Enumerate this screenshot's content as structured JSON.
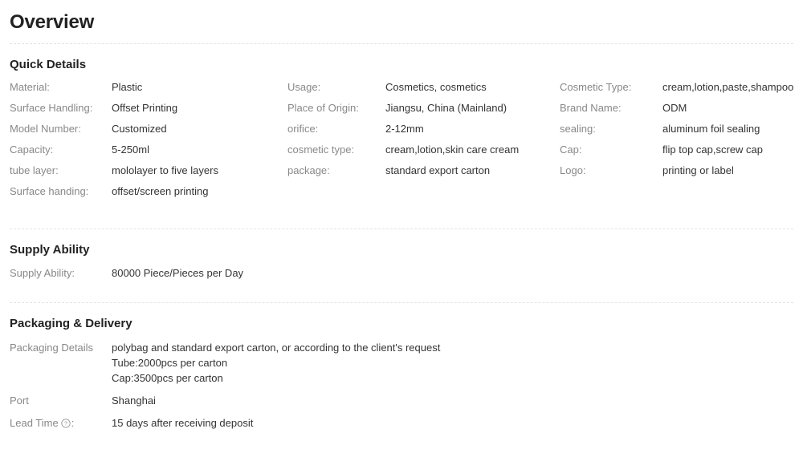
{
  "page": {
    "title": "Overview"
  },
  "quick_details": {
    "heading": "Quick Details",
    "columns": [
      {
        "rows": [
          {
            "label": "Material:",
            "value": "Plastic"
          },
          {
            "label": "Surface Handling:",
            "value": "Offset Printing"
          },
          {
            "label": "Model Number:",
            "value": "Customized"
          },
          {
            "label": "Capacity:",
            "value": "5-250ml"
          },
          {
            "label": "tube layer:",
            "value": "mololayer to five layers"
          },
          {
            "label": "Surface handing:",
            "value": "offset/screen printing"
          }
        ]
      },
      {
        "rows": [
          {
            "label": "Usage:",
            "value": "Cosmetics, cosmetics"
          },
          {
            "label": "Place of Origin:",
            "value": "Jiangsu, China (Mainland)"
          },
          {
            "label": "orifice:",
            "value": "2-12mm"
          },
          {
            "label": "cosmetic type:",
            "value": "cream,lotion,skin care cream"
          },
          {
            "label": "package:",
            "value": "standard export carton"
          }
        ]
      },
      {
        "rows": [
          {
            "label": "Cosmetic Type:",
            "value": "cream,lotion,paste,shampoo"
          },
          {
            "label": "Brand Name:",
            "value": "ODM"
          },
          {
            "label": "sealing:",
            "value": "aluminum foil sealing"
          },
          {
            "label": "Cap:",
            "value": "flip top cap,screw cap"
          },
          {
            "label": "Logo:",
            "value": "printing or label"
          }
        ]
      }
    ]
  },
  "supply_ability": {
    "heading": "Supply Ability",
    "label": "Supply Ability:",
    "value": "80000 Piece/Pieces per Day"
  },
  "packaging_delivery": {
    "heading": "Packaging & Delivery",
    "packaging": {
      "label": "Packaging Details",
      "lines": [
        "polybag and standard export carton, or according to the client's request",
        "Tube:2000pcs per carton",
        "Cap:3500pcs per carton"
      ]
    },
    "port": {
      "label": "Port",
      "value": "Shanghai"
    },
    "lead_time": {
      "label_prefix": "Lead Time",
      "label_suffix": ":",
      "icon": "help-circle-icon",
      "value": "15 days after receiving deposit"
    }
  },
  "colors": {
    "label": "#888888",
    "value": "#333333",
    "heading": "#222222",
    "divider": "#e4e4e4"
  }
}
